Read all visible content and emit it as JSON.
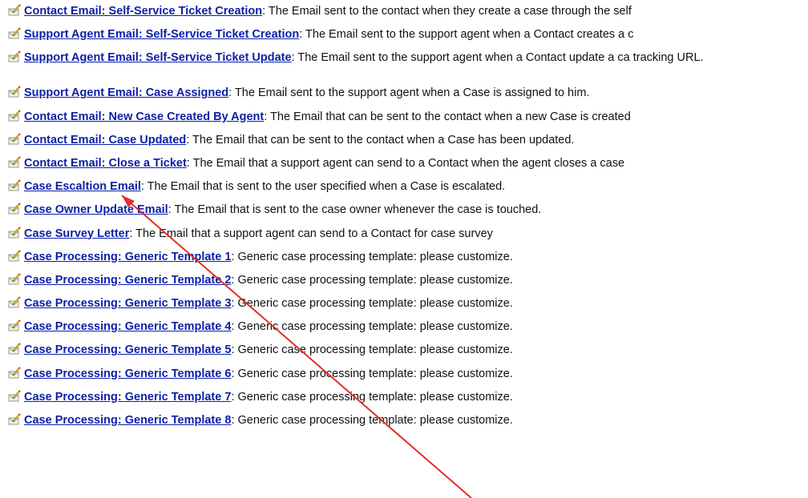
{
  "templates": [
    {
      "title": "Contact Email: Self-Service Ticket Creation",
      "separator": ":",
      "description": " The Email sent to the contact when they create a case through the self"
    },
    {
      "title": "Support Agent Email: Self-Service Ticket Creation",
      "separator": ":",
      "description": " The Email sent to the support agent when a Contact creates a c"
    },
    {
      "title": "Support Agent Email: Self-Service Ticket Update",
      "separator": ":",
      "description": " The Email sent to the support agent when a Contact update a ca tracking URL."
    },
    {
      "title": "Support Agent Email: Case Assigned",
      "separator": ":",
      "description": " The Email sent to the support agent when a Case is assigned to him."
    },
    {
      "title": "Contact Email: New Case Created By Agent",
      "separator": ":",
      "description": " The Email that can be sent to the contact when a new Case is created"
    },
    {
      "title": "Contact Email: Case Updated",
      "separator": ":",
      "description": " The Email that can be sent to the contact when a Case has been updated."
    },
    {
      "title": "Contact Email: Close a Ticket",
      "separator": ":",
      "description": " The Email that a support agent can send to a Contact when the agent closes a case"
    },
    {
      "title": "Case Escaltion Email",
      "separator": ":",
      "description": " The Email that is sent to the user specified when a Case is escalated."
    },
    {
      "title": "Case Owner Update Email",
      "separator": ":",
      "description": " The Email that is sent to the case owner whenever the case is touched."
    },
    {
      "title": "Case Survey Letter",
      "separator": ":",
      "description": " The Email that a support agent can send to a Contact for case survey"
    },
    {
      "title": "Case Processing: Generic Template 1",
      "separator": ":",
      "description": " Generic case processing template: please customize."
    },
    {
      "title": "Case Processing: Generic Template 2",
      "separator": ":",
      "description": " Generic case processing template: please customize."
    },
    {
      "title": "Case Processing: Generic Template 3",
      "separator": ":",
      "description": " Generic case processing template: please customize."
    },
    {
      "title": "Case Processing: Generic Template 4",
      "separator": ":",
      "description": " Generic case processing template: please customize."
    },
    {
      "title": "Case Processing: Generic Template 5",
      "separator": ":",
      "description": " Generic case processing template: please customize."
    },
    {
      "title": "Case Processing: Generic Template 6",
      "separator": ":",
      "description": " Generic case processing template: please customize."
    },
    {
      "title": "Case Processing: Generic Template 7",
      "separator": ":",
      "description": " Generic case processing template: please customize."
    },
    {
      "title": "Case Processing: Generic Template 8",
      "separator": ":",
      "description": " Generic case processing template: please customize."
    }
  ],
  "icons": {
    "template_icon": "envelope-pencil-icon"
  },
  "colors": {
    "link": "#0a1fa8",
    "arrow": "#e0302a",
    "text": "#111111",
    "background": "#ffffff"
  },
  "annotation": {
    "type": "arrow",
    "points_to": "Contact Email: Case Updated"
  }
}
